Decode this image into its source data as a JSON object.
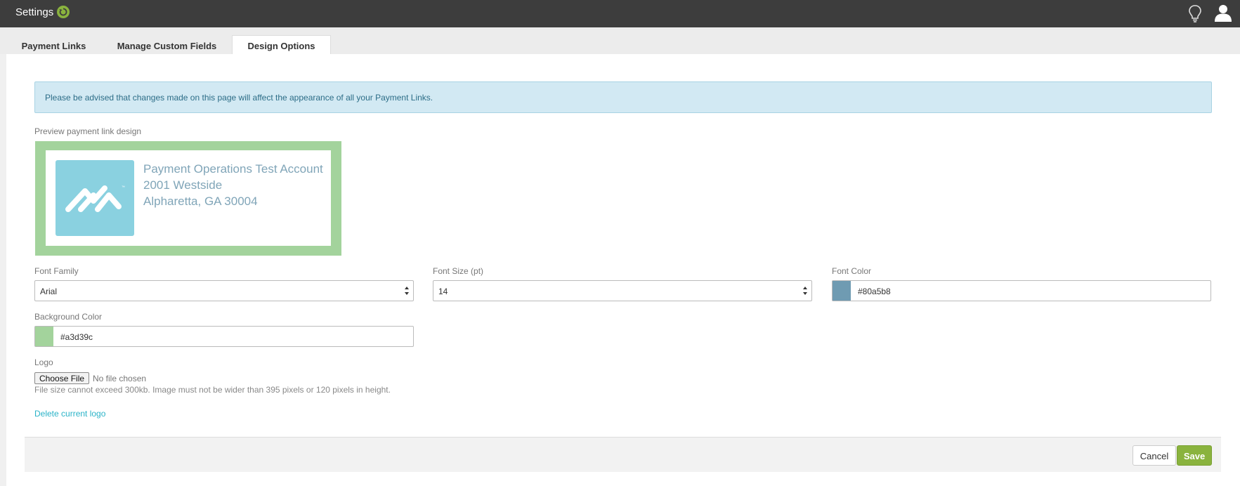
{
  "header": {
    "title": "Settings",
    "refresh_icon": "refresh-icon",
    "bulb_icon": "lightbulb-icon",
    "user_icon": "user-icon"
  },
  "tabs": [
    {
      "label": "Payment Links",
      "active": false
    },
    {
      "label": "Manage Custom Fields",
      "active": false
    },
    {
      "label": "Design Options",
      "active": true
    }
  ],
  "alert": {
    "text": "Please be advised that changes made on this page will affect the appearance of all your Payment Links."
  },
  "preview": {
    "label": "Preview payment link design",
    "lines": [
      "Payment Operations Test Account",
      "2001 Westside",
      "Alpharetta, GA 30004"
    ],
    "background_color": "#a3d39c",
    "font_color": "#80a5b8"
  },
  "fields": {
    "font_family": {
      "label": "Font Family",
      "value": "Arial"
    },
    "font_size": {
      "label": "Font Size (pt)",
      "value": "14"
    },
    "font_color": {
      "label": "Font Color",
      "value": "#80a5b8"
    },
    "background_color": {
      "label": "Background Color",
      "value": "#a3d39c"
    }
  },
  "logo": {
    "label": "Logo",
    "choose_label": "Choose File",
    "no_file": "No file chosen",
    "hint": "File size cannot exceed 300kb. Image must not be wider than 395 pixels or 120 pixels in height.",
    "delete_label": "Delete current logo"
  },
  "footer": {
    "cancel_label": "Cancel",
    "save_label": "Save"
  }
}
